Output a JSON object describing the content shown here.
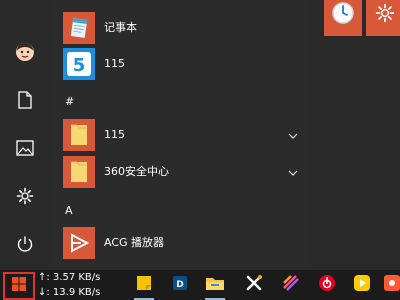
{
  "start_menu": {
    "rail": {
      "items": [
        {
          "name": "user-avatar",
          "icon": "avatar-icon"
        },
        {
          "name": "documents",
          "icon": "document-icon"
        },
        {
          "name": "pictures",
          "icon": "image-icon"
        },
        {
          "name": "settings",
          "icon": "gear-icon"
        },
        {
          "name": "power",
          "icon": "power-icon"
        }
      ]
    },
    "app_list": {
      "apps_top": [
        {
          "label": "记事本",
          "icon": "notepad-icon",
          "tile_color": "#d8583a"
        },
        {
          "label": "115",
          "icon": "115-app-icon",
          "tile_color": "#ffffff"
        }
      ],
      "section_hash": "#",
      "apps_hash": [
        {
          "label": "115",
          "icon": "folder-icon",
          "tile_color": "#d8583a",
          "expandable": true
        },
        {
          "label": "360安全中心",
          "icon": "folder-icon",
          "tile_color": "#d8583a",
          "expandable": true
        }
      ],
      "section_a": "A",
      "apps_a": [
        {
          "label": "ACG 播放器",
          "icon": "acg-player-icon",
          "tile_color": "#d8583a"
        }
      ]
    },
    "tiles": [
      {
        "name": "alarms-clock",
        "icon": "clock-icon"
      },
      {
        "name": "second-tile",
        "icon": "gear-icon"
      }
    ]
  },
  "taskbar": {
    "start_icon": "windows-logo-icon",
    "net_speed": {
      "upload": "↑: 3.57 KB/s",
      "download": "↓: 13.9 KB/s"
    },
    "apps": [
      {
        "name": "sticky-notes",
        "icon": "sticky-notes-icon",
        "color": "#f5c400"
      },
      {
        "name": "dictionary-app",
        "icon": "dictionary-icon",
        "color": "#1e90ff"
      },
      {
        "name": "file-explorer",
        "icon": "folder-icon",
        "color": "#f2c14e"
      },
      {
        "name": "tool-app",
        "icon": "x-tool-icon",
        "color": "#ff9f1c"
      },
      {
        "name": "media-app",
        "icon": "stripes-icon",
        "color": "#ff4d8d"
      },
      {
        "name": "netease-music",
        "icon": "netease-music-icon",
        "color": "#e60026"
      },
      {
        "name": "video-app",
        "icon": "play-icon",
        "color": "#ffcc00"
      },
      {
        "name": "viewer-app",
        "icon": "eye-icon",
        "color": "#ff5a36"
      }
    ]
  }
}
